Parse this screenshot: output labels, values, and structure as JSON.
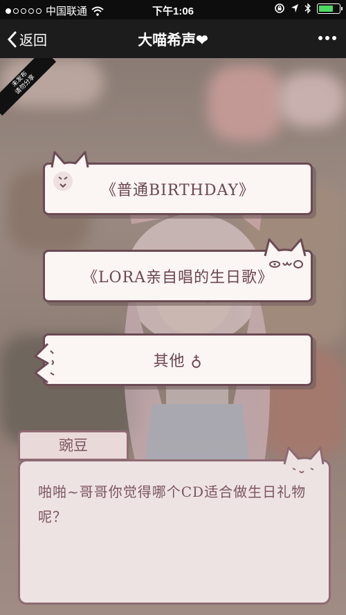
{
  "status_bar": {
    "carrier": "中国联通",
    "time": "下午1:06",
    "battery_level": 0.75,
    "signal_bars_filled": 1
  },
  "navbar": {
    "back_label": "返回",
    "title": "大喵希声❤"
  },
  "ribbon": {
    "line1": "未发布",
    "line2": "请勿分享"
  },
  "choices": [
    {
      "label": "《普通BIRTHDAY》"
    },
    {
      "label": "《LORA亲自唱的生日歌》"
    },
    {
      "label": "其他 ♁"
    }
  ],
  "dialog": {
    "speaker": "豌豆",
    "text": "啪啪~哥哥你觉得哪个CD适合做生日礼物呢？"
  },
  "colors": {
    "accent": "#6b4a53",
    "choice_bg": "#fbf5f4",
    "battery": "#4cd964"
  }
}
